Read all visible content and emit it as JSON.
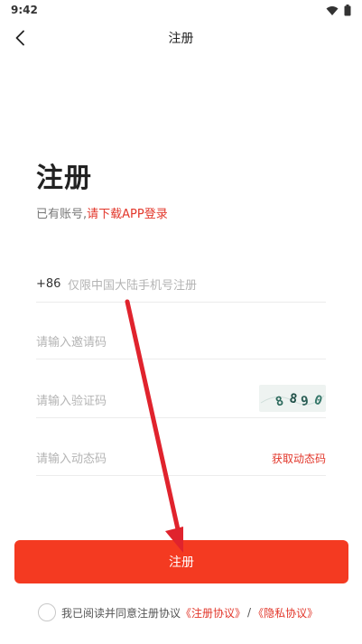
{
  "status_bar": {
    "time": "9:42"
  },
  "app_bar": {
    "title": "注册",
    "back_icon": "chevron-left-icon"
  },
  "heading": {
    "title": "注册",
    "subtitle_prefix": "已有账号,",
    "subtitle_link": "请下载APP登录"
  },
  "form": {
    "phone": {
      "prefix": "+86",
      "placeholder": "仅限中国大陆手机号注册",
      "value": ""
    },
    "invite_code": {
      "placeholder": "请输入邀请码",
      "value": ""
    },
    "captcha": {
      "placeholder": "请输入验证码",
      "value": "",
      "image_text": "8890"
    },
    "sms_code": {
      "placeholder": "请输入动态码",
      "value": "",
      "get_code_label": "获取动态码"
    }
  },
  "submit_label": "注册",
  "agreement": {
    "text": "我已阅读并同意注册协议",
    "link_register": "《注册协议》",
    "separator": "/",
    "link_privacy": "《隐私协议》"
  },
  "colors": {
    "accent": "#f43a21",
    "link": "#e2362a",
    "annotation_arrow": "#e0232d"
  }
}
